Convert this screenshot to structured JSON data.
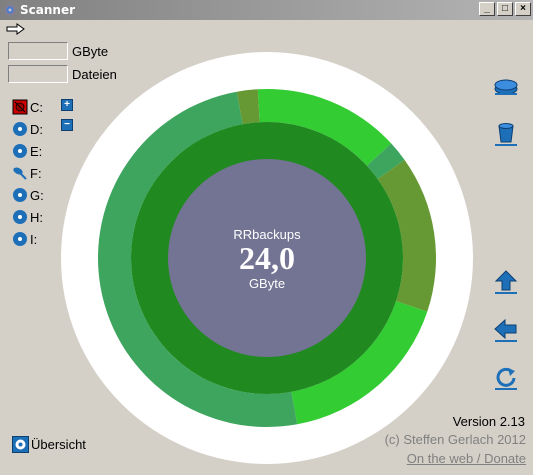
{
  "window": {
    "title": "Scanner",
    "minimize": "_",
    "maximize": "□",
    "close": "×"
  },
  "fields": {
    "size_label": "GByte",
    "size_value": "",
    "files_label": "Dateien",
    "files_value": ""
  },
  "drives": [
    {
      "label": "C:",
      "icon": "hard-disk-red-icon"
    },
    {
      "label": "D:",
      "icon": "cd-drive-icon"
    },
    {
      "label": "E:",
      "icon": "cd-drive-icon"
    },
    {
      "label": "F:",
      "icon": "network-drive-icon"
    },
    {
      "label": "G:",
      "icon": "cd-drive-icon"
    },
    {
      "label": "H:",
      "icon": "cd-drive-icon"
    },
    {
      "label": "I:",
      "icon": "cd-drive-icon"
    }
  ],
  "center": {
    "name": "RRbackups",
    "value": "24,0",
    "unit": "GByte"
  },
  "footer": {
    "version": "Version 2.13",
    "copyright": "(c) Steffen Gerlach 2012",
    "link": "On the web / Donate",
    "overview": "Übersicht"
  },
  "colors": {
    "window_bg": "#d4d0c8",
    "center": "#737393",
    "inner_ring": "#208a20",
    "outer_ring_main": "#3ea55e",
    "outer_ring_bright": "#33cc33",
    "outer_ring_olive": "#669933",
    "white_ring": "#ffffff"
  },
  "chart_data": {
    "type": "pie",
    "center_label": "RRbackups",
    "center_value": "24,0",
    "center_unit": "GByte",
    "rings": [
      {
        "level": 1,
        "segments": [
          {
            "fraction": 1.0,
            "color": "#208a20"
          }
        ]
      },
      {
        "level": 2,
        "segments": [
          {
            "fraction": 0.02,
            "color": "#669933"
          },
          {
            "fraction": 0.14,
            "color": "#33cc33"
          },
          {
            "fraction": 0.02,
            "color": "#3ea55e"
          },
          {
            "fraction": 0.15,
            "color": "#669933"
          },
          {
            "fraction": 0.17,
            "color": "#33cc33"
          },
          {
            "fraction": 0.5,
            "color": "#3ea55e"
          }
        ]
      }
    ]
  }
}
